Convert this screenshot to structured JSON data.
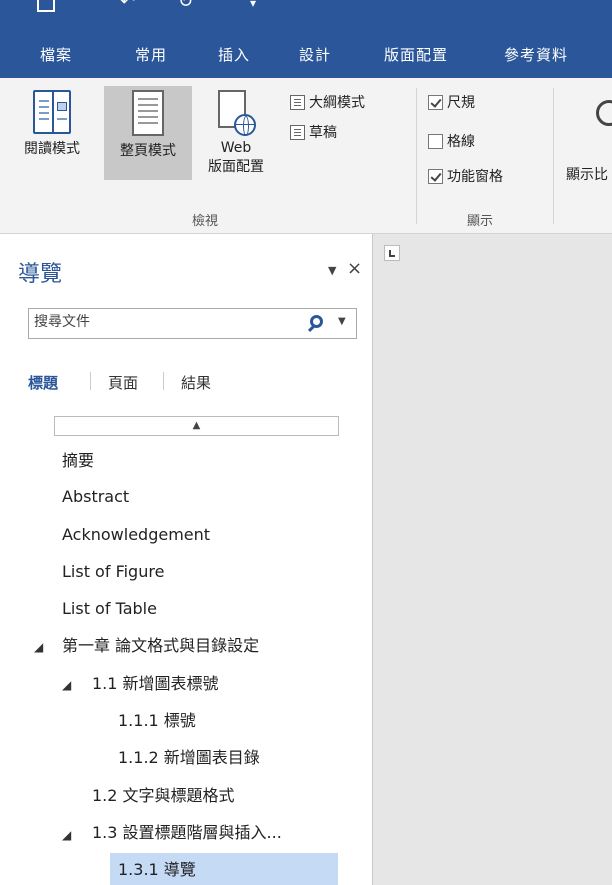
{
  "ribbon_tabs": [
    "檔案",
    "常用",
    "插入",
    "設計",
    "版面配置",
    "參考資料"
  ],
  "view_group": {
    "read_mode": "閱讀模式",
    "print_layout": "整頁模式",
    "web_layout_1": "Web",
    "web_layout_2": "版面配置",
    "outline": "大綱模式",
    "draft": "草稿",
    "label": "檢視"
  },
  "show_group": {
    "ruler": {
      "label": "尺規",
      "checked": true
    },
    "gridlines": {
      "label": "格線",
      "checked": false
    },
    "nav_pane": {
      "label": "功能窗格",
      "checked": true
    },
    "label": "顯示"
  },
  "zoom_group": {
    "label_partial": "顯示比"
  },
  "nav_pane": {
    "title": "導覽",
    "search_placeholder": "搜尋文件",
    "tabs": [
      "標題",
      "頁面",
      "結果"
    ],
    "active_tab": "標題",
    "headings": [
      {
        "text": "摘要",
        "level": 1,
        "expanded": null
      },
      {
        "text": "Abstract",
        "level": 1,
        "expanded": null
      },
      {
        "text": "Acknowledgement",
        "level": 1,
        "expanded": null
      },
      {
        "text": "List of Figure",
        "level": 1,
        "expanded": null
      },
      {
        "text": "List of Table",
        "level": 1,
        "expanded": null
      },
      {
        "text": "第一章 論文格式與目錄設定",
        "level": 1,
        "expanded": true
      },
      {
        "text": "1.1 新增圖表標號",
        "level": 2,
        "expanded": true
      },
      {
        "text": "1.1.1 標號",
        "level": 3,
        "expanded": null
      },
      {
        "text": "1.1.2 新增圖表目錄",
        "level": 3,
        "expanded": null
      },
      {
        "text": "1.2 文字與標題格式",
        "level": 2,
        "expanded": null
      },
      {
        "text": "1.3 設置標題階層與插入...",
        "level": 2,
        "expanded": true
      },
      {
        "text": "1.3.1 導覽",
        "level": 3,
        "expanded": null,
        "selected": true
      }
    ]
  },
  "colors": {
    "accent": "#2b579a",
    "selection": "#c5daf5",
    "ribbon_bg": "#f3f3f3"
  }
}
